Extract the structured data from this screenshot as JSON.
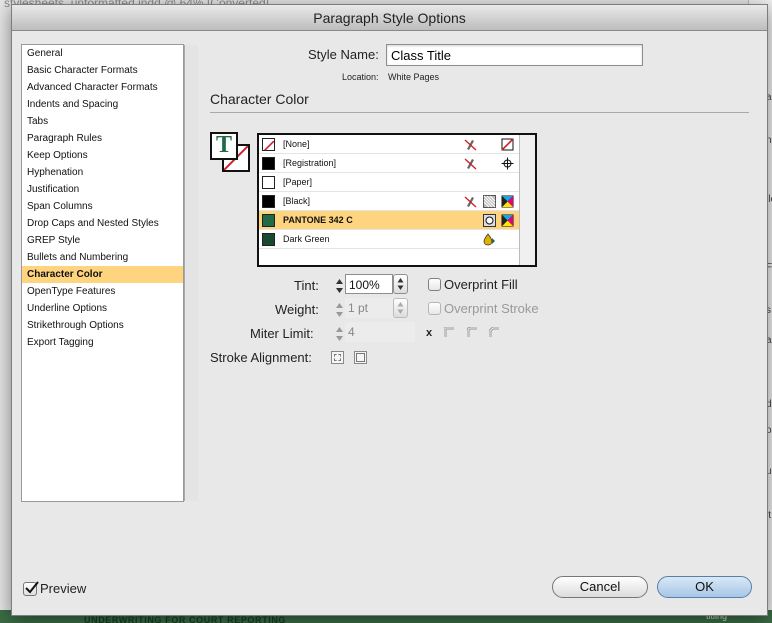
{
  "background": {
    "doc_title": "stylesheets_unformatted.indd @ 64% [Converted]",
    "strip_chars": [
      "a",
      "n",
      "lle",
      "F",
      "s",
      "a",
      "d",
      "o",
      "us",
      "lt"
    ],
    "bottom_text": "UNDERWRITING FOR COURT REPORTING",
    "bottom_right": "titling"
  },
  "dialog": {
    "title": "Paragraph Style Options",
    "categories": [
      "General",
      "Basic Character Formats",
      "Advanced Character Formats",
      "Indents and Spacing",
      "Tabs",
      "Paragraph Rules",
      "Keep Options",
      "Hyphenation",
      "Justification",
      "Span Columns",
      "Drop Caps and Nested Styles",
      "GREP Style",
      "Bullets and Numbering",
      "Character Color",
      "OpenType Features",
      "Underline Options",
      "Strikethrough Options",
      "Export Tagging"
    ],
    "selected_category": "Character Color",
    "style_name_label": "Style Name:",
    "style_name_value": "Class Title",
    "location_label": "Location:",
    "location_value": "White Pages",
    "section_title": "Character Color",
    "swatches": [
      {
        "name": "[None]",
        "chip": "none",
        "icon_a": "no-edit-icon",
        "icon_b": "none-swatch-icon"
      },
      {
        "name": "[Registration]",
        "chip": "#000000",
        "icon_a": "no-edit-icon",
        "icon_b": "registration-icon"
      },
      {
        "name": "[Paper]",
        "chip": "#ffffff",
        "icon_a": "",
        "icon_b": ""
      },
      {
        "name": "[Black]",
        "chip": "#000000",
        "icon_a": "no-edit-icon",
        "icon_b": "process-cmyk-icon"
      },
      {
        "name": "PANTONE 342 C",
        "chip": "#1f6b45",
        "icon_a": "spot-color-icon",
        "icon_b": "cmyk-mode-icon"
      },
      {
        "name": "Dark Green",
        "chip": "#184a30",
        "icon_a": "",
        "icon_b": "gradient-drop-icon"
      }
    ],
    "selected_swatch": "PANTONE 342 C",
    "tint_label": "Tint:",
    "tint_value": "100%",
    "overprint_fill_label": "Overprint Fill",
    "overprint_fill_checked": false,
    "weight_label": "Weight:",
    "weight_value": "1 pt",
    "overprint_stroke_label": "Overprint Stroke",
    "overprint_stroke_checked": false,
    "miter_label": "Miter Limit:",
    "miter_value": "4",
    "miter_x": "x",
    "stroke_alignment_label": "Stroke Alignment:",
    "preview_label": "Preview",
    "preview_checked": true,
    "cancel_label": "Cancel",
    "ok_label": "OK"
  }
}
